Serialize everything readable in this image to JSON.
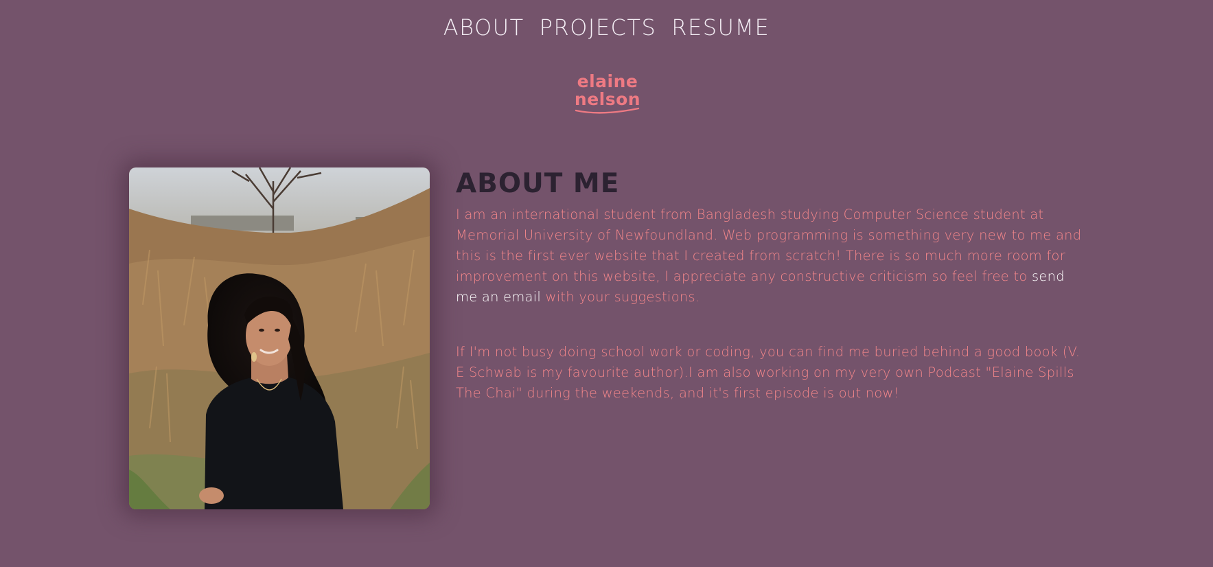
{
  "nav": {
    "items": [
      {
        "label": "ABOUT"
      },
      {
        "label": "PROJECTS"
      },
      {
        "label": "RESUME"
      }
    ]
  },
  "logo": {
    "line1": "elaine",
    "line2": "nelson"
  },
  "about": {
    "heading": "ABOUT ME",
    "para1_before": "I am an international student from Bangladesh studying Computer Science student at Memorial University of Newfoundland. Web programming is something very new to me and this is the first ever website that I created from scratch! There is so much more room for improvement on this website, I appreciate any constructive criticism so feel free to ",
    "email_link": "send me an email",
    "para1_after": " with your suggestions.",
    "para2": "If I'm not busy doing school work or coding, you can find me buried behind a good book (V. E Schwab is my favourite author).I am also working on my very own Podcast \"Elaine Spills The Chai\" during the weekends, and it's first episode is out now!"
  },
  "colors": {
    "background": "#74536b",
    "accent": "#f3868a",
    "heading": "#2c2231",
    "nav_text": "#f4eef5",
    "link": "#ffffff"
  }
}
